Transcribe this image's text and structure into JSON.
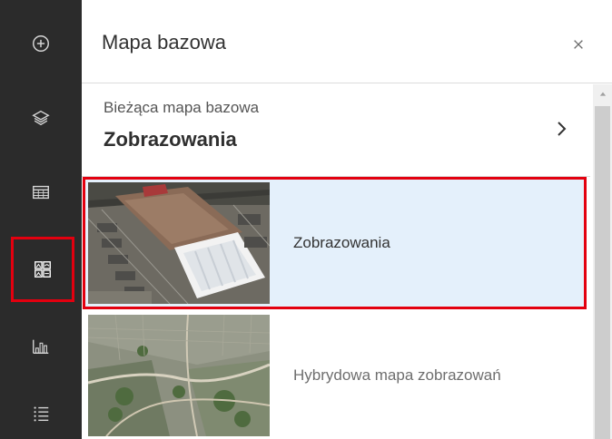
{
  "toolbar": {
    "items": [
      {
        "name": "add",
        "icon": "plus-circle-icon"
      },
      {
        "name": "layers",
        "icon": "layers-icon"
      },
      {
        "name": "table",
        "icon": "table-icon"
      },
      {
        "name": "basemap-gallery",
        "icon": "basemap-gallery-icon",
        "active": true
      },
      {
        "name": "charts",
        "icon": "bar-chart-icon"
      },
      {
        "name": "legend",
        "icon": "list-icon"
      }
    ],
    "highlight_color": "#e3000f"
  },
  "panel": {
    "title": "Mapa bazowa",
    "close_icon": "close-icon",
    "current": {
      "label": "Bieżąca mapa bazowa",
      "value": "Zobrazowania"
    },
    "basemaps": [
      {
        "label": "Zobrazowania",
        "selected": true,
        "thumbnail": "satellite-imagery-thumbnail"
      },
      {
        "label": "Hybrydowa mapa zobrazowań",
        "selected": false,
        "thumbnail": "hybrid-imagery-thumbnail"
      }
    ]
  }
}
